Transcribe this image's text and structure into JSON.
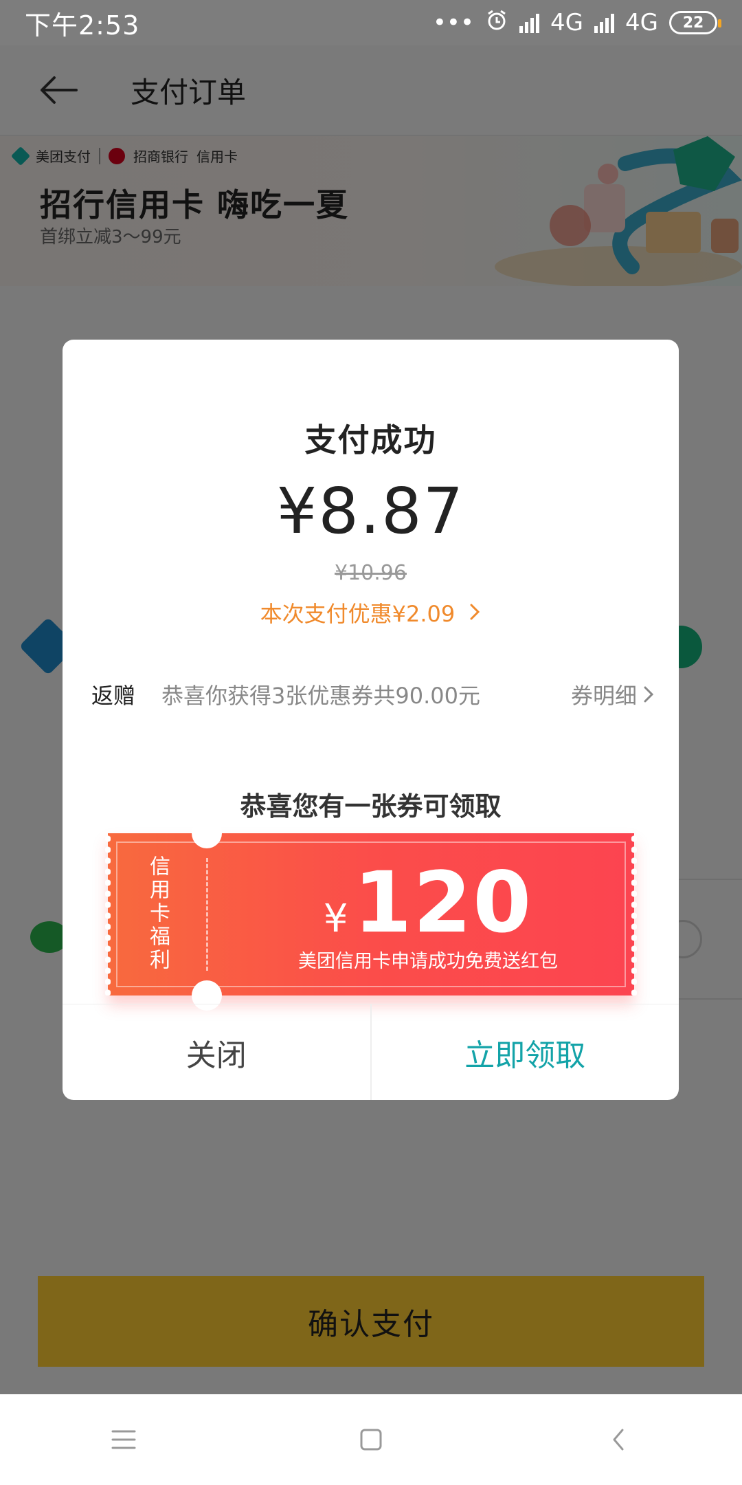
{
  "status_bar": {
    "time": "下午2:53",
    "dots": "•••",
    "net1": "4G",
    "net2": "4G",
    "battery": "22"
  },
  "header": {
    "title": "支付订单"
  },
  "banner": {
    "brand1": "美团支付",
    "brand2": "招商银行",
    "brand3": "信用卡",
    "title": "招行信用卡 嗨吃一夏",
    "subtitle": "首绑立减3～99元"
  },
  "dialog": {
    "title": "支付成功",
    "amount": "¥8.87",
    "original_amount": "¥10.96",
    "discount_text": "本次支付优惠¥2.09",
    "rebate": {
      "label": "返赠",
      "text": "恭喜你获得3张优惠券共90.00元",
      "link": "券明细"
    },
    "coupon_heading": "恭喜您有一张券可领取",
    "coupon": {
      "side_label": "信用卡福利",
      "currency": "¥",
      "value": "120",
      "description": "美团信用卡申请成功免费送红包"
    },
    "close_label": "关闭",
    "claim_label": "立即领取"
  },
  "confirm_button": "确认支付",
  "colors": {
    "accent_orange": "#f08a2c",
    "claim_teal": "#13a3a8",
    "coupon_red": "#fc4450",
    "confirm_yellow": "#ffcc33"
  }
}
